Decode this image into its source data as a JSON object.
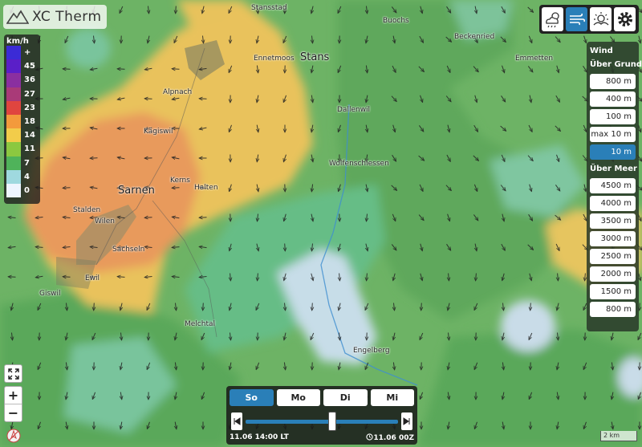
{
  "app": {
    "title": "XC Therm"
  },
  "legend": {
    "unit": "km/h",
    "entries": [
      {
        "label": "+",
        "color": "#3b2bd6"
      },
      {
        "label": "45",
        "color": "#5a1fc8"
      },
      {
        "label": "36",
        "color": "#8a2fa0"
      },
      {
        "label": "27",
        "color": "#a93a78"
      },
      {
        "label": "23",
        "color": "#e0453f"
      },
      {
        "label": "18",
        "color": "#f39a3c"
      },
      {
        "label": "14",
        "color": "#f2cc4a"
      },
      {
        "label": "11",
        "color": "#8cc840"
      },
      {
        "label": "7",
        "color": "#4fb35a"
      },
      {
        "label": "4",
        "color": "#9fd9df"
      },
      {
        "label": "0",
        "color": "#eef5ff"
      }
    ]
  },
  "toolbar": {
    "items": [
      {
        "name": "cloud-sun-icon",
        "active": false
      },
      {
        "name": "wind-icon",
        "active": true
      },
      {
        "name": "thermal-sun-icon",
        "active": false
      },
      {
        "name": "gear-icon",
        "active": false
      }
    ],
    "colors": {
      "active": "#2a7fb8"
    }
  },
  "wind_panel": {
    "title": "Wind",
    "agl_heading": "Über Grund",
    "agl_levels": [
      "800 m",
      "400 m",
      "100 m",
      "max 10 m",
      "10 m"
    ],
    "active_level": "10 m",
    "amsl_heading": "Über Meer",
    "amsl_levels": [
      "4500 m",
      "4000 m",
      "3500 m",
      "3000 m",
      "2500 m",
      "2000 m",
      "1500 m",
      "800 m"
    ]
  },
  "places": [
    {
      "name": "Stansstad",
      "big": false
    },
    {
      "name": "Buochs",
      "big": false
    },
    {
      "name": "Beckenried",
      "big": false
    },
    {
      "name": "Emmetten",
      "big": false
    },
    {
      "name": "Ennetmoos",
      "big": false
    },
    {
      "name": "Stans",
      "big": true
    },
    {
      "name": "Alpnach",
      "big": false
    },
    {
      "name": "Dallenwil",
      "big": false
    },
    {
      "name": "Kägiswil",
      "big": false
    },
    {
      "name": "Wolfenschiessen",
      "big": false
    },
    {
      "name": "Kerns",
      "big": false
    },
    {
      "name": "Halten",
      "big": false
    },
    {
      "name": "Sarnen",
      "big": true
    },
    {
      "name": "Stalden",
      "big": false
    },
    {
      "name": "Wilen",
      "big": false
    },
    {
      "name": "Sachseln",
      "big": false
    },
    {
      "name": "Ewil",
      "big": false
    },
    {
      "name": "Giswil",
      "big": false
    },
    {
      "name": "Melchtal",
      "big": false
    },
    {
      "name": "Engelberg",
      "big": false
    }
  ],
  "time": {
    "days": [
      "So",
      "Mo",
      "Di",
      "Mi"
    ],
    "active_day": "So",
    "local_time": "11.06 14:00 LT",
    "model_run": "11.06 00Z",
    "slider_position": 0.57
  },
  "scale": {
    "label": "2 km"
  },
  "controls": {
    "zoom_in": "+",
    "zoom_out": "−"
  }
}
